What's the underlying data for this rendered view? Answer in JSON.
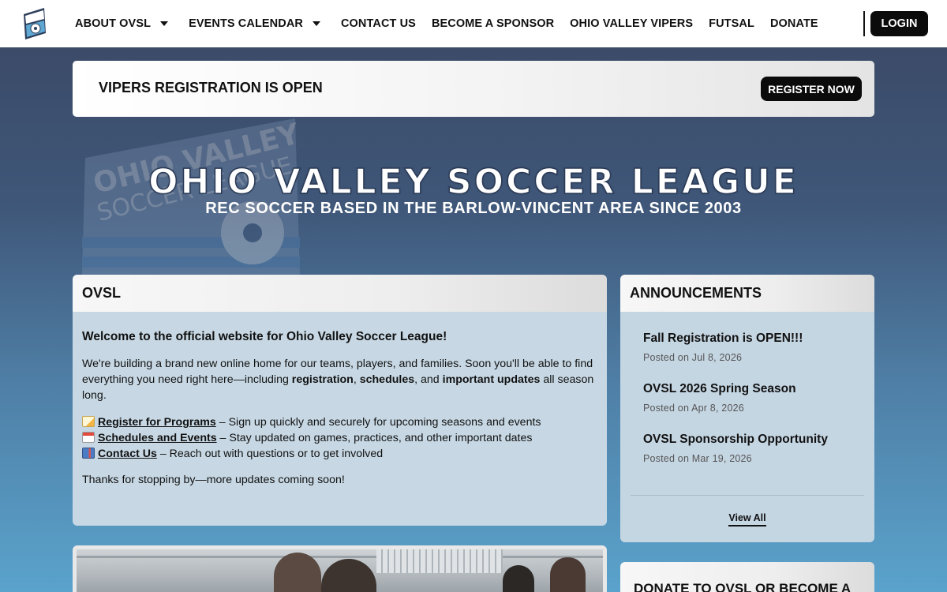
{
  "nav": {
    "items": [
      {
        "label": "ABOUT OVSL",
        "dropdown": true
      },
      {
        "label": "EVENTS CALENDAR",
        "dropdown": true
      },
      {
        "label": "CONTACT US",
        "dropdown": false
      },
      {
        "label": "BECOME A SPONSOR",
        "dropdown": false
      },
      {
        "label": "OHIO VALLEY VIPERS",
        "dropdown": false
      },
      {
        "label": "FUTSAL",
        "dropdown": false
      },
      {
        "label": "DONATE",
        "dropdown": false
      }
    ],
    "login_label": "LOGIN"
  },
  "banner": {
    "title": "VIPERS REGISTRATION IS OPEN",
    "button_label": "REGISTER NOW"
  },
  "hero": {
    "title": "OHIO VALLEY SOCCER LEAGUE",
    "subtitle": "REC SOCCER BASED IN THE BARLOW-VINCENT AREA SINCE 2003",
    "logo_text_line1": "OHIO VALLEY",
    "logo_text_line2": "SOCCER LEAGUE"
  },
  "ovsl_card": {
    "heading": "OVSL",
    "welcome": "Welcome to the official website for Ohio Valley Soccer League!",
    "intro_part1": "We're building a brand new online home for our teams, players, and families. Soon you'll be able to find everything you need right here—including ",
    "intro_bold1": "registration",
    "intro_sep1": ", ",
    "intro_bold2": "schedules",
    "intro_sep2": ", and ",
    "intro_bold3": "important updates",
    "intro_part2": " all season long.",
    "links": [
      {
        "icon": "memo-icon",
        "link": "Register for Programs",
        "text": " – Sign up quickly and securely for upcoming seasons and events"
      },
      {
        "icon": "calendar-icon",
        "link": "Schedules and Events",
        "text": " – Stay updated on games, practices, and other important dates"
      },
      {
        "icon": "mailbox-icon",
        "link": "Contact Us",
        "text": " – Reach out with questions or to get involved"
      }
    ],
    "thanks": "Thanks for stopping by—more updates coming soon!"
  },
  "announcements": {
    "heading": "ANNOUNCEMENTS",
    "items": [
      {
        "title": "Fall Registration is OPEN!!!",
        "date": "Posted on Jul 8, 2026"
      },
      {
        "title": "OVSL 2026 Spring Season",
        "date": "Posted on Apr 8, 2026"
      },
      {
        "title": "OVSL Sponsorship Opportunity",
        "date": "Posted on Mar 19, 2026"
      }
    ],
    "view_all": "View All"
  },
  "donate_card": {
    "heading": "DONATE TO OVSL OR BECOME A"
  },
  "colors": {
    "nav_bg": "#ffffff",
    "button_bg": "#0b0b0b",
    "page_gradient_top": "#3a4763",
    "page_gradient_bottom": "#5aa3cc",
    "card_bg": "#c7d8e4"
  }
}
